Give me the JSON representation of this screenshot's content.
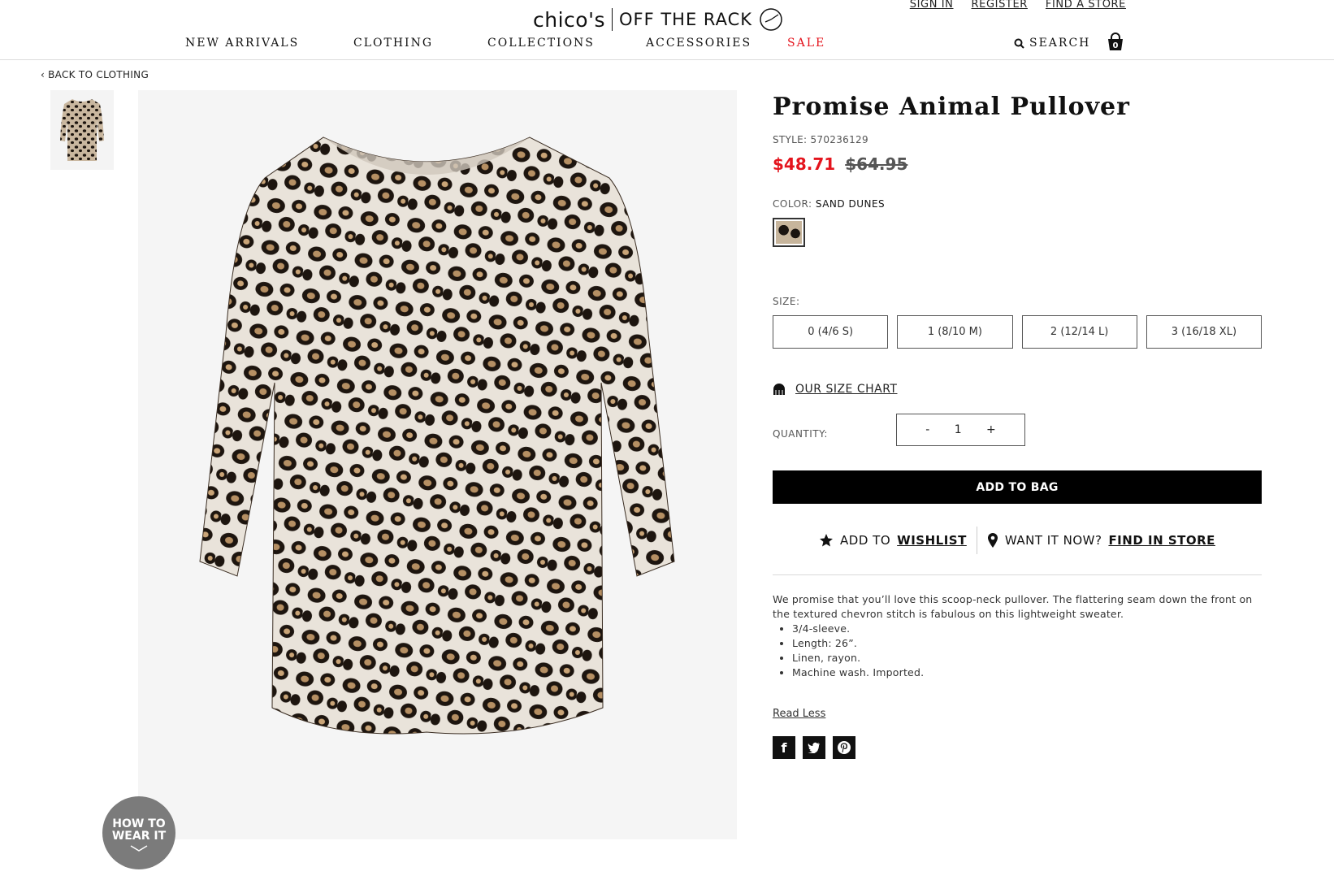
{
  "header": {
    "logo_brand": "chico's",
    "logo_sub": "OFF THE RACK",
    "util_links": [
      "SIGN IN",
      "REGISTER",
      "FIND A STORE"
    ],
    "nav": [
      "NEW ARRIVALS",
      "CLOTHING",
      "COLLECTIONS",
      "ACCESSORIES",
      "SALE"
    ],
    "search_label": "SEARCH",
    "bag_count": "0"
  },
  "breadcrumb": {
    "back_label": "BACK TO CLOTHING"
  },
  "product": {
    "title": "Promise Animal Pullover",
    "style": "STYLE: 570236129",
    "price_sale": "$48.71",
    "price_original": "$64.95",
    "color_label": "COLOR:",
    "color_value": "SAND DUNES",
    "size_label": "SIZE:",
    "sizes": [
      "0 (4/6 S)",
      "1 (8/10 M)",
      "2 (12/14 L)",
      "3 (16/18 XL)"
    ],
    "size_chart_label": "OUR SIZE CHART",
    "quantity_label": "QUANTITY:",
    "qty_minus": "-",
    "quantity": "1",
    "qty_plus": "+",
    "add_to_bag": "ADD TO BAG",
    "wishlist_prefix": "ADD TO",
    "wishlist_link": "WISHLIST",
    "store_prefix": "WANT IT NOW?",
    "store_link": "FIND IN STORE",
    "description": "We promise that you’ll love this scoop-neck pullover. The flattering seam down the front on the textured chevron stitch is fabulous on this lightweight sweater.",
    "bullets": [
      "3/4-sleeve.",
      "Length: 26”.",
      "Linen, rayon.",
      "Machine wash. Imported."
    ],
    "read_less": "Read Less"
  },
  "how_to_wear": {
    "line1": "HOW TO",
    "line2": "WEAR IT"
  },
  "social": {
    "facebook": "f",
    "twitter": "t",
    "pinterest": "p"
  },
  "colors": {
    "sale": "#e4141d",
    "button": "#000000"
  }
}
